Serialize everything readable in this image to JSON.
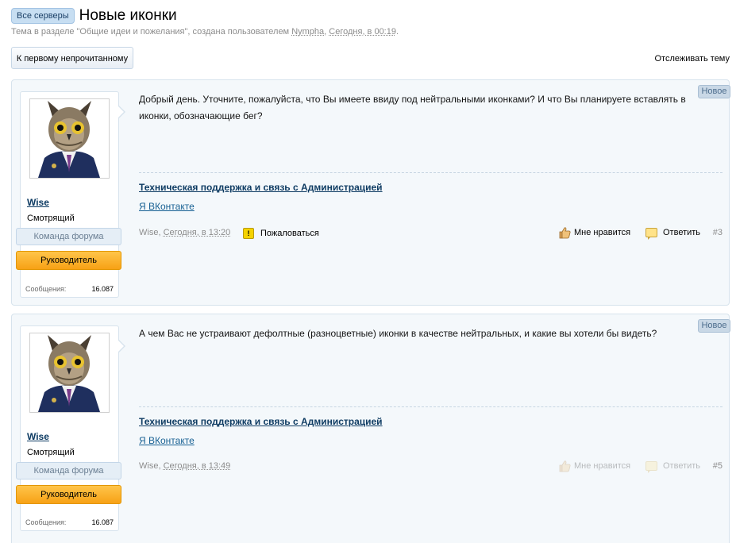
{
  "header": {
    "prefix": "Все серверы",
    "title": "Новые иконки",
    "subtitle_pre": "Тема в разделе \"Общие идеи и пожелания\", создана пользователем ",
    "subtitle_user": "Nympha",
    "subtitle_sep": ", ",
    "subtitle_date": "Сегодня, в 00:19",
    "subtitle_end": "."
  },
  "toolbar": {
    "unread_button": "К первому непрочитанному",
    "watch_link": "Отслеживать тему"
  },
  "posts": [
    {
      "badge": "Новое",
      "author": "Wise",
      "user_title": "Смотрящий",
      "banner_team": "Команда форума",
      "banner_lead": "Руководитель",
      "stat_label": "Сообщения:",
      "stat_value": "16.087",
      "message": "Добрый день. Уточните, пожалуйста, что Вы имеете ввиду под нейтральными иконками? И что Вы планируете вставлять в иконки, обозначающие бег?",
      "signature_link1": "Техническая поддержка и связь с Администрацией",
      "signature_link2": "Я ВКонтакте",
      "meta_author": "Wise",
      "meta_sep": ", ",
      "meta_date": "Сегодня, в 13:20",
      "report": "Пожаловаться",
      "like": "Мне нравится",
      "reply": "Ответить",
      "number": "#3"
    },
    {
      "badge": "Новое",
      "author": "Wise",
      "user_title": "Смотрящий",
      "banner_team": "Команда форума",
      "banner_lead": "Руководитель",
      "stat_label": "Сообщения:",
      "stat_value": "16.087",
      "message": "А чем Вас не устраивают дефолтные (разноцветные) иконки в качестве нейтральных, и какие вы хотели бы видеть?",
      "signature_link1": "Техническая поддержка и связь с Администрацией",
      "signature_link2": "Я ВКонтакте",
      "meta_author": "Wise",
      "meta_sep": ", ",
      "meta_date": "Сегодня, в 13:49",
      "like": "Мне нравится",
      "reply": "Ответить",
      "number": "#5"
    }
  ],
  "colors": {
    "accent_link": "#176093",
    "banner_lead": "#f7a115",
    "post_background": "#f4f8fb"
  },
  "icons": {
    "avatar": "owl-in-suit-avatar",
    "report": "warning-icon",
    "like": "thumbs-up-icon",
    "reply": "speech-bubble-icon"
  }
}
